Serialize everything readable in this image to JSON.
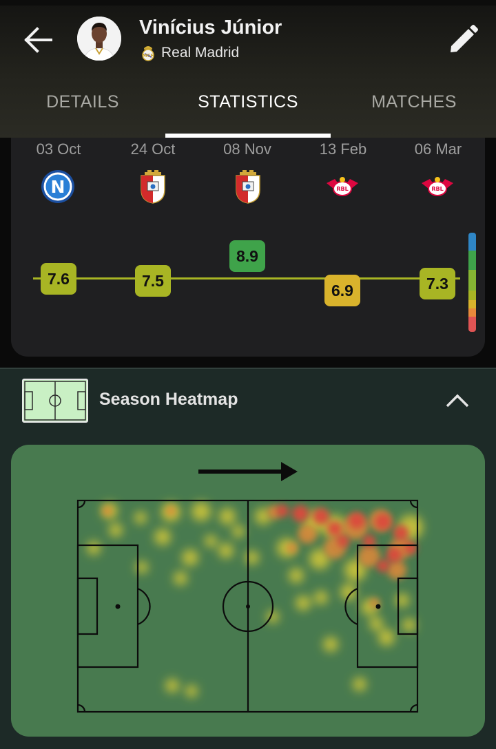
{
  "header": {
    "player_name": "Vinícius Júnior",
    "team_name": "Real Madrid",
    "back_icon": "arrow-left-icon",
    "edit_icon": "pencil-icon"
  },
  "tabs": [
    {
      "label": "DETAILS",
      "active": false
    },
    {
      "label": "STATISTICS",
      "active": true
    },
    {
      "label": "MATCHES",
      "active": false
    }
  ],
  "matches": [
    {
      "date": "03 Oct",
      "opponent_crest": "napoli-crest",
      "rating": "7.6",
      "rating_color": "#a8b524"
    },
    {
      "date": "24 Oct",
      "opponent_crest": "braga-crest",
      "rating": "7.5",
      "rating_color": "#a8b524"
    },
    {
      "date": "08 Nov",
      "opponent_crest": "braga-crest",
      "rating": "8.9",
      "rating_color": "#3fa34a"
    },
    {
      "date": "13 Feb",
      "opponent_crest": "rb-leipzig-crest",
      "rating": "6.9",
      "rating_color": "#d9b32c"
    },
    {
      "date": "06 Mar",
      "opponent_crest": "rb-leipzig-crest",
      "rating": "7.3",
      "rating_color": "#a8b524"
    }
  ],
  "rating_scale_colors": [
    "#2f86c6",
    "#3fa34a",
    "#86b533",
    "#a8b524",
    "#d9b32c",
    "#e8893b",
    "#e05454"
  ],
  "heatmap": {
    "title": "Season Heatmap",
    "collapse_icon": "chevron-up-icon",
    "direction_icon": "arrow-right-icon",
    "pitch_color": "#487a4f"
  }
}
